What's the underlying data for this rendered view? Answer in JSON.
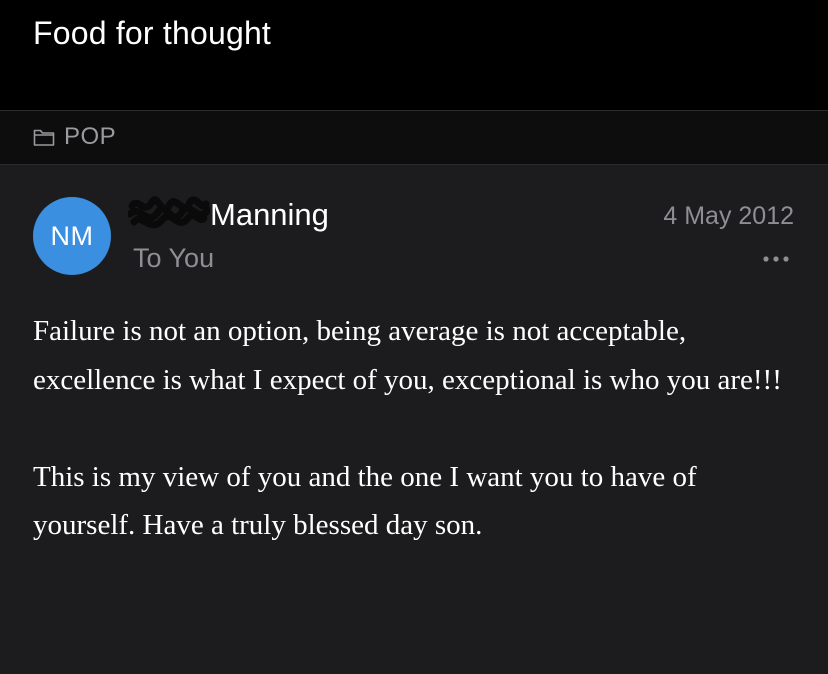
{
  "message": {
    "subject": "Food for thought",
    "folder": {
      "label": "POP",
      "icon": "folder-icon"
    },
    "sender": {
      "initials": "NM",
      "name": "Manning",
      "avatar_color": "#3a8fe0"
    },
    "recipient": "To You",
    "date": "4 May 2012",
    "more_icon": "more-options-icon",
    "body": {
      "paragraphs": [
        "Failure is not an option, being average is not acceptable, excellence is what I expect of you, exceptional is who you are!!!",
        "This is my view of you and the one I want you to have of yourself.  Have a truly blessed day son."
      ]
    }
  }
}
